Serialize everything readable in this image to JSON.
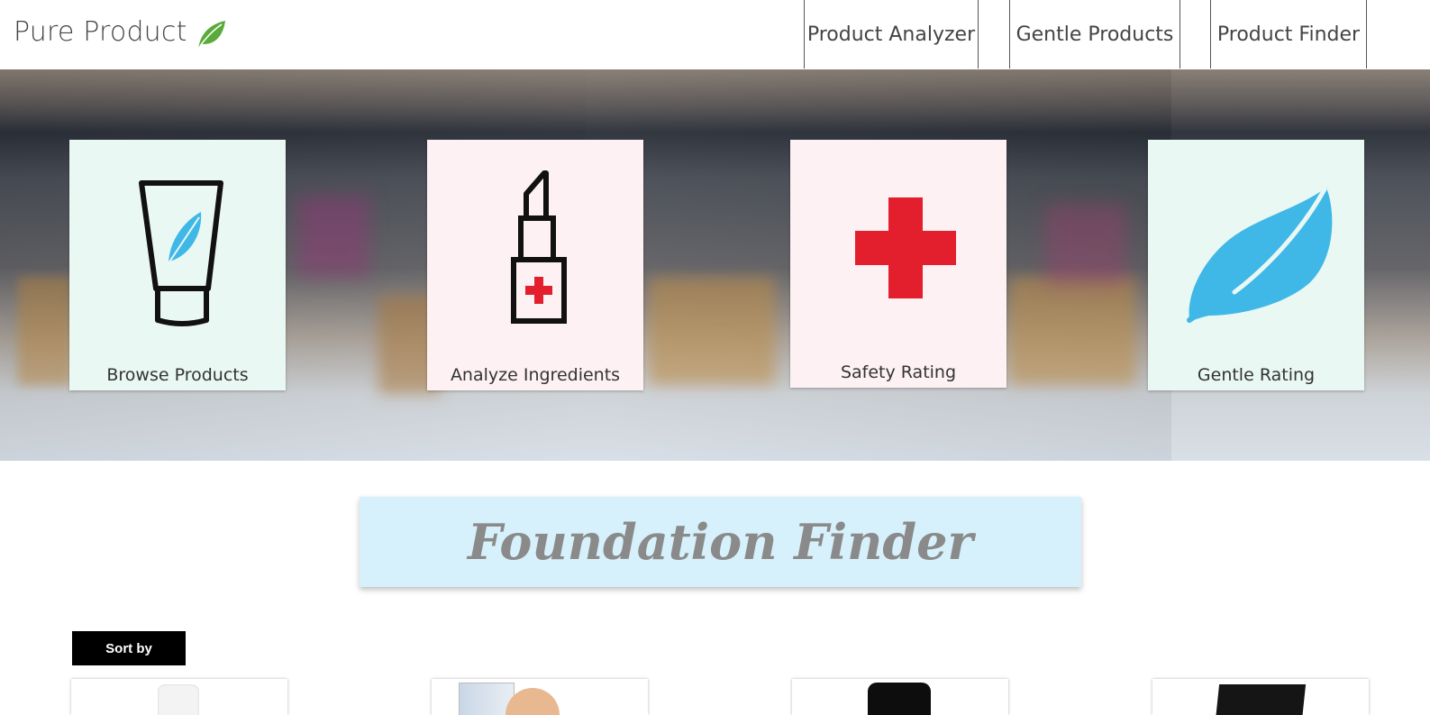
{
  "brand": {
    "name": "Pure Product",
    "logo_icon": "leaf-icon",
    "logo_color": "#5aaa3c"
  },
  "nav": {
    "items": [
      "Product Analyzer",
      "Gentle Products",
      "Product Finder"
    ]
  },
  "hero": {
    "tiles": [
      {
        "label": "Browse Products",
        "icon": "tube-feather-icon",
        "background": "#e9f8f3"
      },
      {
        "label": "Analyze Ingredients",
        "icon": "lipstick-cross-icon",
        "background": "#fdf1f3"
      },
      {
        "label": "Safety Rating",
        "icon": "red-cross-icon",
        "background": "#fdf1f3"
      },
      {
        "label": "Gentle Rating",
        "icon": "feather-icon",
        "background": "#e9f8f3"
      }
    ]
  },
  "finder": {
    "title": "Foundation Finder",
    "banner_color": "#d6f1fb"
  },
  "sort": {
    "label": "Sort by"
  },
  "colors": {
    "feather_blue": "#3fb8e8",
    "cross_red": "#e31e2d"
  }
}
